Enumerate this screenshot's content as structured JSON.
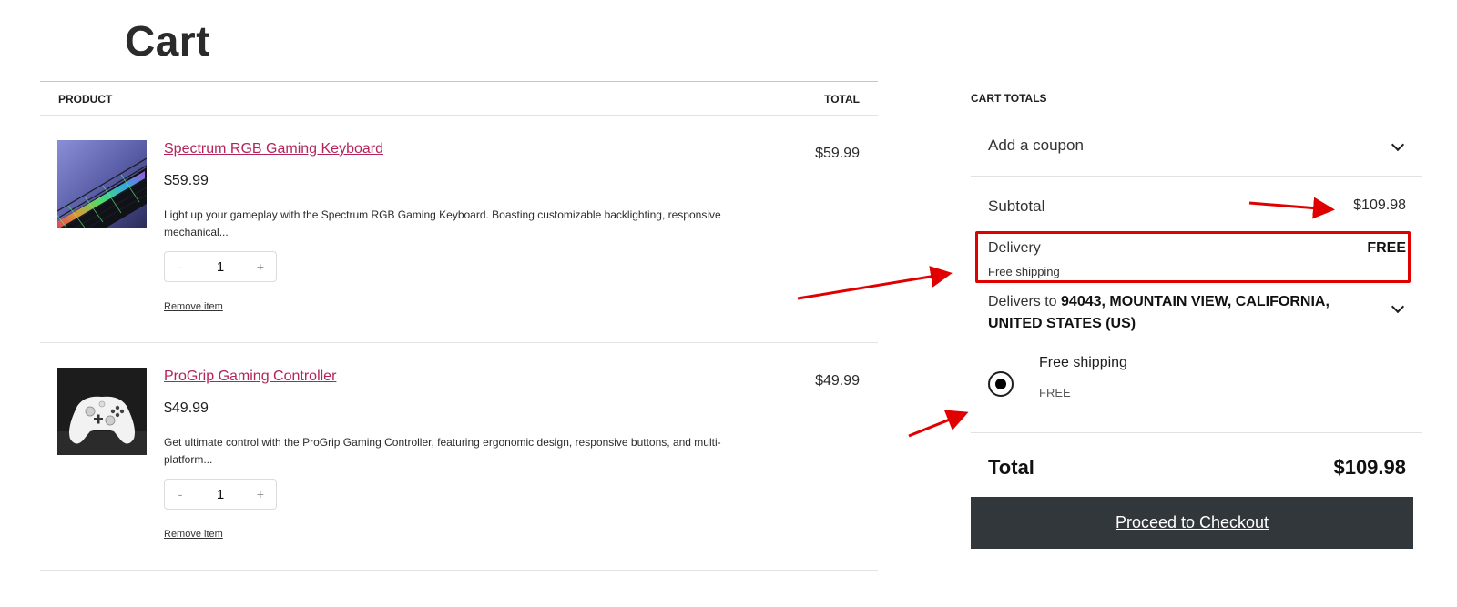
{
  "page": {
    "title": "Cart"
  },
  "products_table": {
    "header_product": "PRODUCT",
    "header_total": "TOTAL"
  },
  "items": [
    {
      "name": "Spectrum RGB Gaming Keyboard",
      "price": "$59.99",
      "description": "Light up your gameplay with the Spectrum RGB Gaming Keyboard. Boasting customizable backlighting, responsive mechanical...",
      "quantity": "1",
      "decrement": "-",
      "increment": "+",
      "remove_label": "Remove item",
      "line_total": "$59.99",
      "image": "keyboard-image"
    },
    {
      "name": "ProGrip Gaming Controller",
      "price": "$49.99",
      "description": "Get ultimate control with the ProGrip Gaming Controller, featuring ergonomic design, responsive buttons, and multi-platform...",
      "quantity": "1",
      "decrement": "-",
      "increment": "+",
      "remove_label": "Remove item",
      "line_total": "$49.99",
      "image": "controller-image"
    }
  ],
  "totals": {
    "heading": "CART TOTALS",
    "coupon_label": "Add a coupon",
    "subtotal_label": "Subtotal",
    "subtotal_value": "$109.98",
    "delivery_label": "Delivery",
    "delivery_sublabel": "Free shipping",
    "delivery_value": "FREE",
    "delivers_to_prefix": "Delivers to ",
    "delivers_to_address": "94043, MOUNTAIN VIEW, CALIFORNIA, UNITED STATES (US)",
    "shipping_option_name": "Free shipping",
    "shipping_option_price": "FREE",
    "total_label": "Total",
    "total_value": "$109.98",
    "checkout_label": "Proceed to Checkout"
  },
  "colors": {
    "link": "#b3245a",
    "checkout_bg": "#32373c",
    "annotation_red": "#e00000"
  }
}
